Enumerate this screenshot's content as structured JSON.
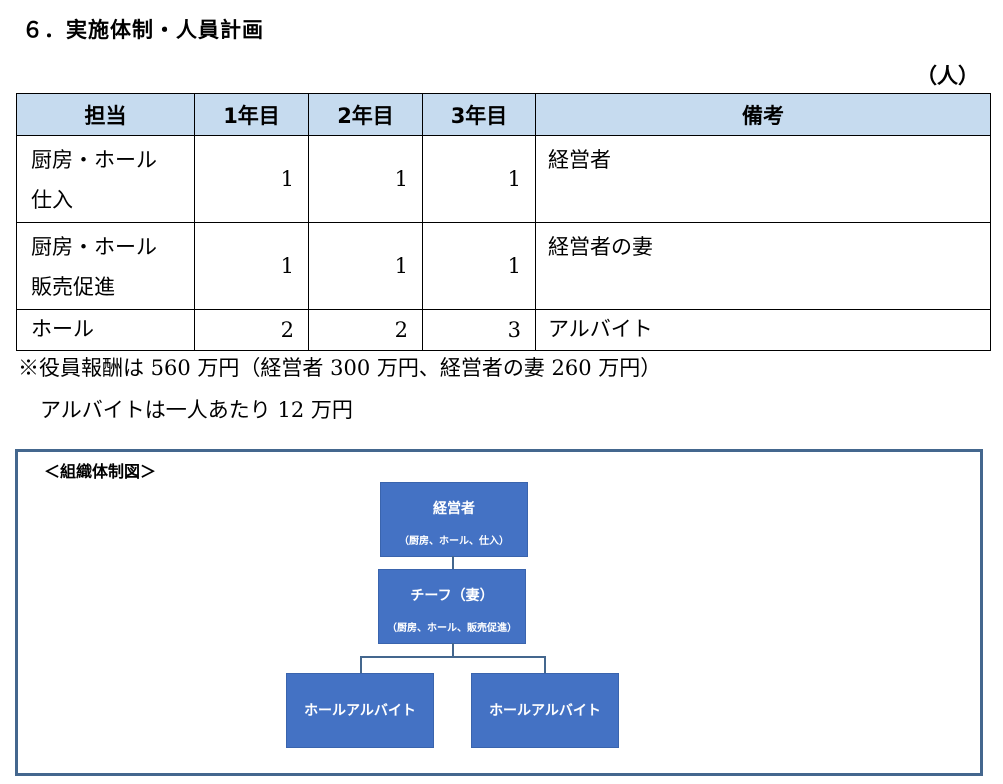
{
  "heading": "６．実施体制・人員計画",
  "unit": "（人）",
  "table": {
    "headers": [
      "担当",
      "1年目",
      "2年目",
      "3年目",
      "備考"
    ],
    "rows": [
      {
        "role": "厨房・ホール\n仕入",
        "y1": "1",
        "y2": "1",
        "y3": "1",
        "note": "経営者"
      },
      {
        "role": "厨房・ホール\n販売促進",
        "y1": "1",
        "y2": "1",
        "y3": "1",
        "note": "経営者の妻"
      },
      {
        "role": "ホール",
        "y1": "2",
        "y2": "2",
        "y3": "3",
        "note": "アルバイト"
      }
    ]
  },
  "notes": {
    "line1": "※役員報酬は 560 万円（経営者 300 万円、経営者の妻 260 万円）",
    "line2": "アルバイトは一人あたり 12 万円"
  },
  "org": {
    "title": "＜組織体制図＞",
    "owner": {
      "title": "経営者",
      "sub": "（厨房、ホール、仕入）"
    },
    "chief": {
      "title": "チーフ（妻）",
      "sub": "（厨房、ホール、販売促進）"
    },
    "staff": [
      {
        "title": "ホールアルバイト"
      },
      {
        "title": "ホールアルバイト"
      }
    ]
  },
  "colors": {
    "header_bg": "#c6dbef",
    "node_bg": "#4472c4",
    "frame": "#44678e"
  }
}
